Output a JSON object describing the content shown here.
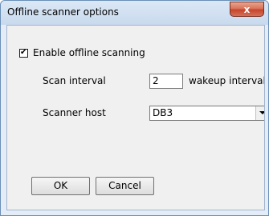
{
  "window": {
    "title": "Offline scanner options"
  },
  "options": {
    "enable_label": "Enable offline scanning",
    "enable_checked": true,
    "scan_interval_label": "Scan interval",
    "scan_interval_value": "2",
    "scan_interval_unit": "wakeup interval(s)",
    "scanner_host_label": "Scanner host",
    "scanner_host_value": "DB3"
  },
  "buttons": {
    "ok_label": "OK",
    "cancel_label": "Cancel"
  },
  "icons": {
    "close": "close-icon",
    "check": "check-icon",
    "dropdown": "chevron-down-icon"
  },
  "colors": {
    "close_button": "#c7452a",
    "dialog_background": "#f0f0f0",
    "frame": "#e4edf7"
  }
}
